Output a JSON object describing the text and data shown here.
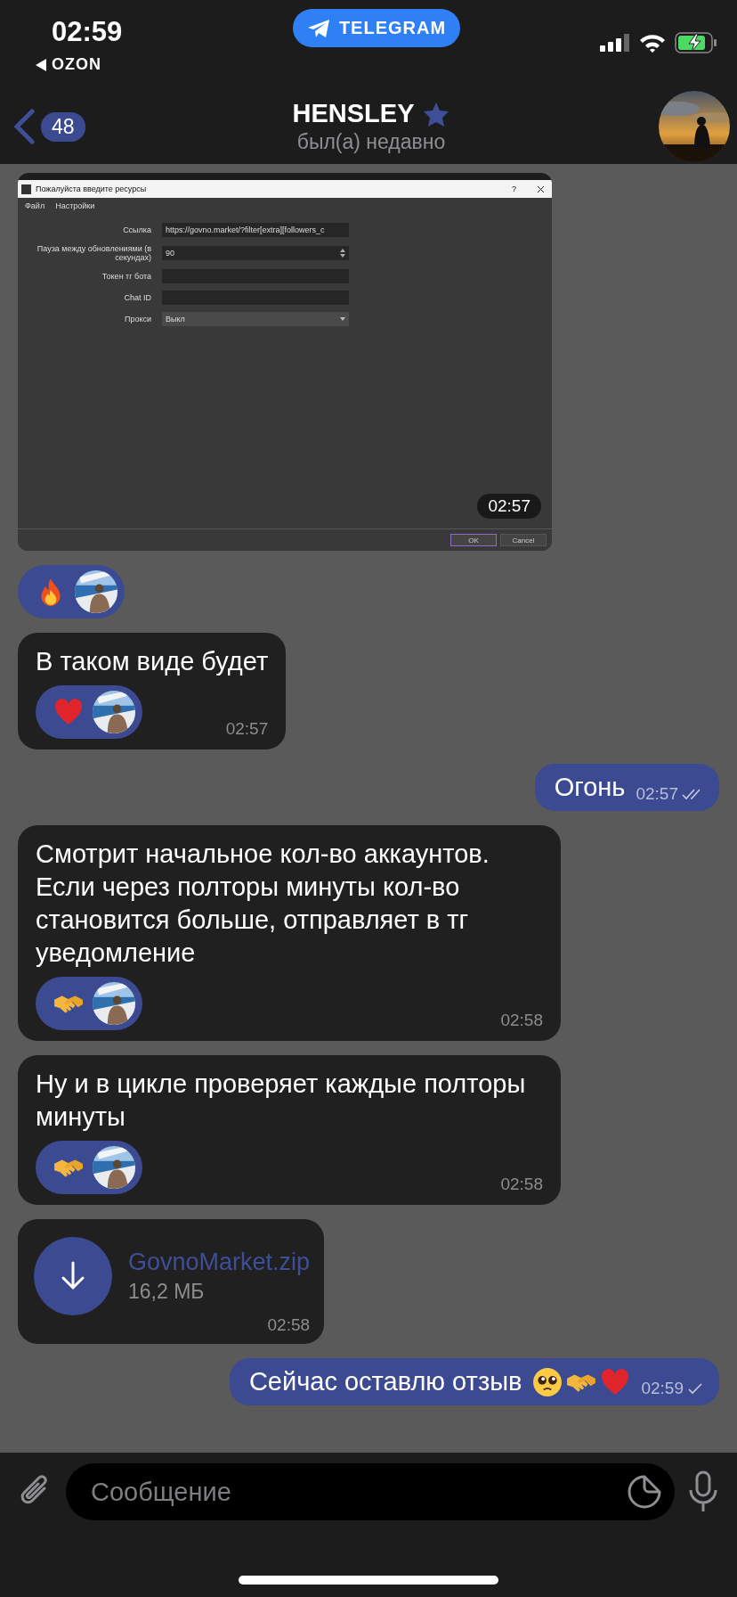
{
  "status_bar": {
    "time": "02:59",
    "back_app": "OZON",
    "pill": "TELEGRAM"
  },
  "header": {
    "back_count": "48",
    "title": "HENSLEY",
    "subtitle": "был(а) недавно"
  },
  "messages": [
    {
      "outgoing": false,
      "time": "02:57",
      "reactions": [
        {
          "kind": "fire"
        }
      ],
      "dialog": {
        "title": "Пожалуйста введите ресурсы",
        "help": "?",
        "menu": [
          "Файл",
          "Настройки"
        ],
        "fields": [
          {
            "kind": "text",
            "label": "Ссылка",
            "value": "https://govno.market/?filter[extra][followers_c"
          },
          {
            "kind": "spin",
            "label": "Пауза между обновлениями (в секундах)",
            "value": "90"
          },
          {
            "kind": "text",
            "label": "Токен тг бота"
          },
          {
            "kind": "text",
            "label": "Chat ID"
          },
          {
            "kind": "select",
            "label": "Прокси",
            "value": "Выкл"
          }
        ],
        "buttons": [
          "OK",
          "Cancel"
        ]
      }
    },
    {
      "kind": "text",
      "outgoing": false,
      "text": "В таком виде будет",
      "reactions": [
        {
          "kind": "heart"
        }
      ],
      "time": "02:57"
    },
    {
      "kind": "text",
      "outgoing": true,
      "text": "Огонь",
      "time": "02:57",
      "read": true
    },
    {
      "kind": "text",
      "outgoing": false,
      "text": "Смотрит начальное кол-во аккаунтов. Если через полторы минуты кол-во становится больше, отправляет в тг уведомление",
      "reactions": [
        {
          "kind": "handshake"
        }
      ],
      "time": "02:58"
    },
    {
      "kind": "text",
      "outgoing": false,
      "text": "Ну и в цикле проверяет каждые полторы минуты",
      "reactions": [
        {
          "kind": "handshake"
        }
      ],
      "time": "02:58"
    },
    {
      "kind": "file",
      "outgoing": false,
      "file_name": "GovnoMarket.zip",
      "size": "16,2 МБ",
      "time": "02:58"
    },
    {
      "kind": "text",
      "outgoing": true,
      "text": "Сейчас оставлю отзыв",
      "emoji": [
        {
          "kind": "pleading"
        },
        {
          "kind": "handshake"
        },
        {
          "kind": "heart"
        }
      ],
      "time": "02:59",
      "read": false
    }
  ],
  "composer": {
    "placeholder": "Сообщение"
  }
}
